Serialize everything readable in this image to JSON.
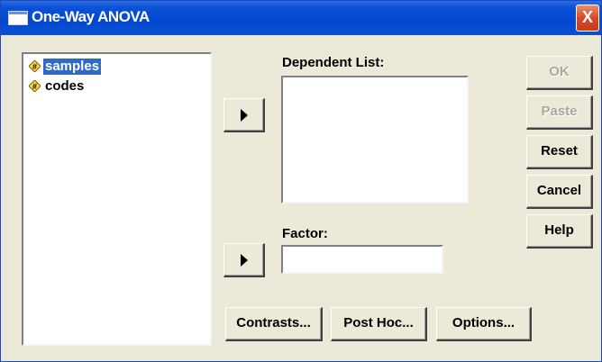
{
  "window": {
    "title": "One-Way ANOVA",
    "close_label": "X"
  },
  "variables": [
    {
      "label": "samples",
      "icon": "scale-variable-icon",
      "selected": true
    },
    {
      "label": "codes",
      "icon": "scale-variable-icon",
      "selected": false
    }
  ],
  "dependent": {
    "label": "Dependent List:"
  },
  "factor": {
    "label": "Factor:",
    "value": ""
  },
  "buttons": {
    "ok": "OK",
    "paste": "Paste",
    "reset": "Reset",
    "cancel": "Cancel",
    "help": "Help",
    "contrasts": "Contrasts...",
    "post_hoc": "Post Hoc...",
    "options": "Options..."
  },
  "colors": {
    "titlebar": "#0a51d8",
    "selection": "#316ac5",
    "dialog_bg": "#ece9d8"
  }
}
